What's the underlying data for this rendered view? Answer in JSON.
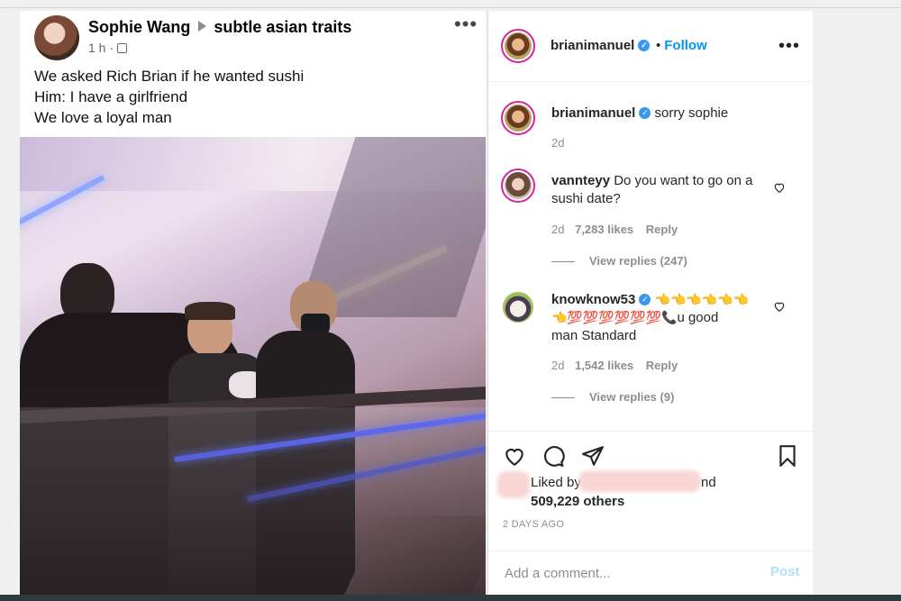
{
  "fb": {
    "author": "Sophie Wang",
    "group": "subtle asian traits",
    "time": "1 h ·",
    "more_label": "•••",
    "lines": [
      "We asked Rich Brian if he wanted sushi",
      "Him: I have a girlfriend",
      "We love a loyal man"
    ]
  },
  "ig": {
    "header": {
      "username": "brianimanuel",
      "separator": "•",
      "follow": "Follow",
      "more_label": "•••"
    },
    "caption": {
      "username": "brianimanuel",
      "text": "sorry sophie",
      "time": "2d"
    },
    "comments": [
      {
        "username": "vannteyy",
        "text": "Do you want to go on a sushi date?",
        "time": "2d",
        "likes": "7,283 likes",
        "reply": "Reply",
        "view_replies": "View replies (247)"
      },
      {
        "username": "knowknow53",
        "emoji_line1": "👈👈👈👈👈👈",
        "emoji_line2": "👈💯💯💯💯💯💯📞",
        "text_tail": "u good",
        "text_line3": "man Standard",
        "time": "2d",
        "likes": "1,542 likes",
        "reply": "Reply",
        "view_replies": "View replies (9)"
      }
    ],
    "liked_by_prefix": "Liked by",
    "liked_by_suffix": "nd",
    "liked_others": "509,229 others",
    "post_time": "2 DAYS AGO",
    "add_comment_placeholder": "Add a comment...",
    "post_label": "Post"
  }
}
